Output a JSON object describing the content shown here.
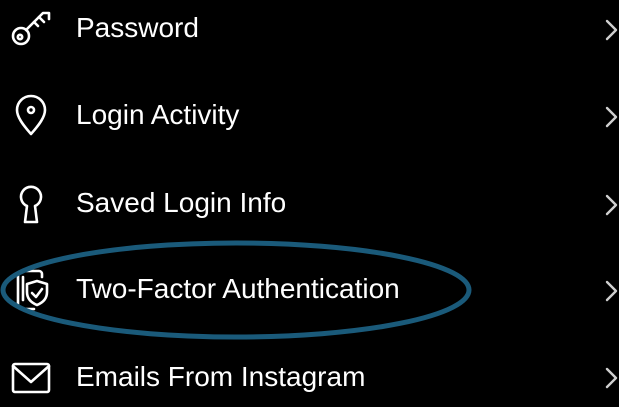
{
  "menu": {
    "items": [
      {
        "label": "Password",
        "icon": "key-icon"
      },
      {
        "label": "Login Activity",
        "icon": "location-pin-icon"
      },
      {
        "label": "Saved Login Info",
        "icon": "keyhole-icon"
      },
      {
        "label": "Two-Factor Authentication",
        "icon": "phone-shield-icon"
      },
      {
        "label": "Emails From Instagram",
        "icon": "envelope-icon"
      }
    ]
  },
  "colors": {
    "background": "#000000",
    "text": "#ffffff",
    "chevron": "#cfcfcf",
    "highlight_ellipse": "#1a5a7a"
  }
}
